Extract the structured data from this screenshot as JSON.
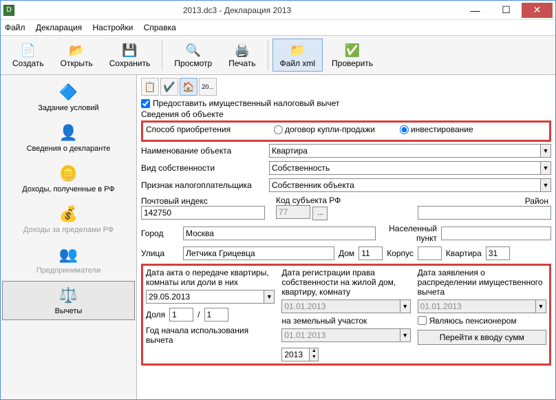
{
  "titlebar": {
    "title": "2013.dc3 - Декларация 2013"
  },
  "menu": {
    "file": "Файл",
    "decl": "Декларация",
    "settings": "Настройки",
    "help": "Справка"
  },
  "toolbar": {
    "create": "Создать",
    "open": "Открыть",
    "save": "Сохранить",
    "preview": "Просмотр",
    "print": "Печать",
    "xml": "Файл xml",
    "check": "Проверить"
  },
  "sidebar": {
    "conditions": "Задание условий",
    "declarant": "Сведения о декларанте",
    "income_rf": "Доходы, полученные в РФ",
    "income_out": "Доходы за пределами РФ",
    "biz": "Предприниматели",
    "deductions": "Вычеты"
  },
  "main": {
    "grant_checkbox": "Предоставить имущественный налоговый вычет",
    "object_section": "Сведения об объекте",
    "acq_method_label": "Способ приобретения",
    "acq_purchase": "договор купли-продажи",
    "acq_invest": "инвестирование",
    "obj_name_label": "Наименование объекта",
    "obj_name_value": "Квартира",
    "own_type_label": "Вид собственности",
    "own_type_value": "Собственность",
    "taxpayer_label": "Признак налогоплательщика",
    "taxpayer_value": "Собственник объекта",
    "postal_label": "Почтовый индекс",
    "postal_value": "142750",
    "subj_label": "Код субъекта РФ",
    "subj_value": "77",
    "district_label": "Район",
    "district_value": "",
    "city_label": "Город",
    "city_value": "Москва",
    "settlement_label": "Населенный пункт",
    "settlement_value": "",
    "street_label": "Улица",
    "street_value": "Летчика Грицевца",
    "house_label": "Дом",
    "house_value": "11",
    "block_label": "Корпус",
    "block_value": "",
    "flat_label": "Квартира",
    "flat_value": "31",
    "act_date_label": "Дата акта о передаче квартиры, комнаты или доли в них",
    "act_date_value": "29.05.2013",
    "share_label": "Доля",
    "share_num": "1",
    "share_den": "1",
    "year_label": "Год начала использования вычета",
    "year_value": "2013",
    "reg_date_label": "Дата регистрации права собственности на жилой дом, квартиру, комнату",
    "reg_date_value": "01.01.2013",
    "land_label": "на земельный участок",
    "land_value": "01.01.2013",
    "appl_date_label": "Дата заявления о распределении имущественного вычета",
    "appl_date_value": "01.01.2013",
    "pensioner": "Являюсь пенсионером",
    "goto_sums": "Перейти к вводу сумм",
    "doc_icon_label": "20..."
  }
}
